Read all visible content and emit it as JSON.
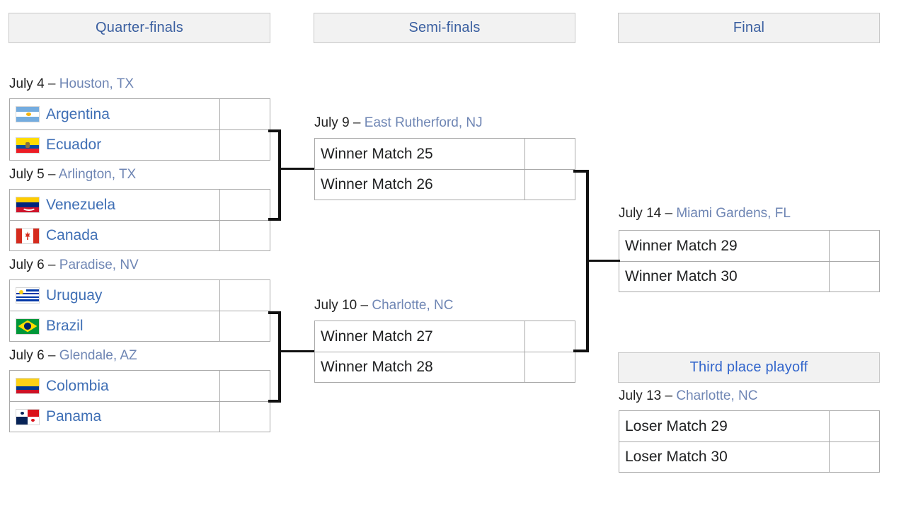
{
  "headers": {
    "quarter_finals": "Quarter-finals",
    "semi_finals": "Semi-finals",
    "final": "Final",
    "third_place": "Third place playoff"
  },
  "colors": {
    "link": "#3f6fb5",
    "venue_link": "#6f86b4",
    "header_text": "#3a5fa0",
    "header_bg": "#f2f2f2",
    "border": "#a9a9a9",
    "connector": "#111111"
  },
  "quarter_finals": [
    {
      "date": "July 4",
      "dash": "–",
      "venue": "Houston, TX",
      "teams": [
        {
          "name": "Argentina",
          "flag": "argentina-flag",
          "score": ""
        },
        {
          "name": "Ecuador",
          "flag": "ecuador-flag",
          "score": ""
        }
      ]
    },
    {
      "date": "July 5",
      "dash": "–",
      "venue": "Arlington, TX",
      "teams": [
        {
          "name": "Venezuela",
          "flag": "venezuela-flag",
          "score": ""
        },
        {
          "name": "Canada",
          "flag": "canada-flag",
          "score": ""
        }
      ]
    },
    {
      "date": "July 6",
      "dash": "–",
      "venue": "Paradise, NV",
      "teams": [
        {
          "name": "Uruguay",
          "flag": "uruguay-flag",
          "score": ""
        },
        {
          "name": "Brazil",
          "flag": "brazil-flag",
          "score": ""
        }
      ]
    },
    {
      "date": "July 6",
      "dash": "–",
      "venue": "Glendale, AZ",
      "teams": [
        {
          "name": "Colombia",
          "flag": "colombia-flag",
          "score": ""
        },
        {
          "name": "Panama",
          "flag": "panama-flag",
          "score": ""
        }
      ]
    }
  ],
  "semi_finals": [
    {
      "date": "July 9",
      "dash": "–",
      "venue": "East Rutherford, NJ",
      "teams": [
        {
          "name": "Winner Match 25",
          "score": ""
        },
        {
          "name": "Winner Match 26",
          "score": ""
        }
      ]
    },
    {
      "date": "July 10",
      "dash": "–",
      "venue": "Charlotte, NC",
      "teams": [
        {
          "name": "Winner Match 27",
          "score": ""
        },
        {
          "name": "Winner Match 28",
          "score": ""
        }
      ]
    }
  ],
  "final": {
    "date": "July 14",
    "dash": "–",
    "venue": "Miami Gardens, FL",
    "teams": [
      {
        "name": "Winner Match 29",
        "score": ""
      },
      {
        "name": "Winner Match 30",
        "score": ""
      }
    ]
  },
  "third_place": {
    "date": "July 13",
    "dash": "–",
    "venue": "Charlotte, NC",
    "teams": [
      {
        "name": "Loser Match 29",
        "score": ""
      },
      {
        "name": "Loser Match 30",
        "score": ""
      }
    ]
  }
}
